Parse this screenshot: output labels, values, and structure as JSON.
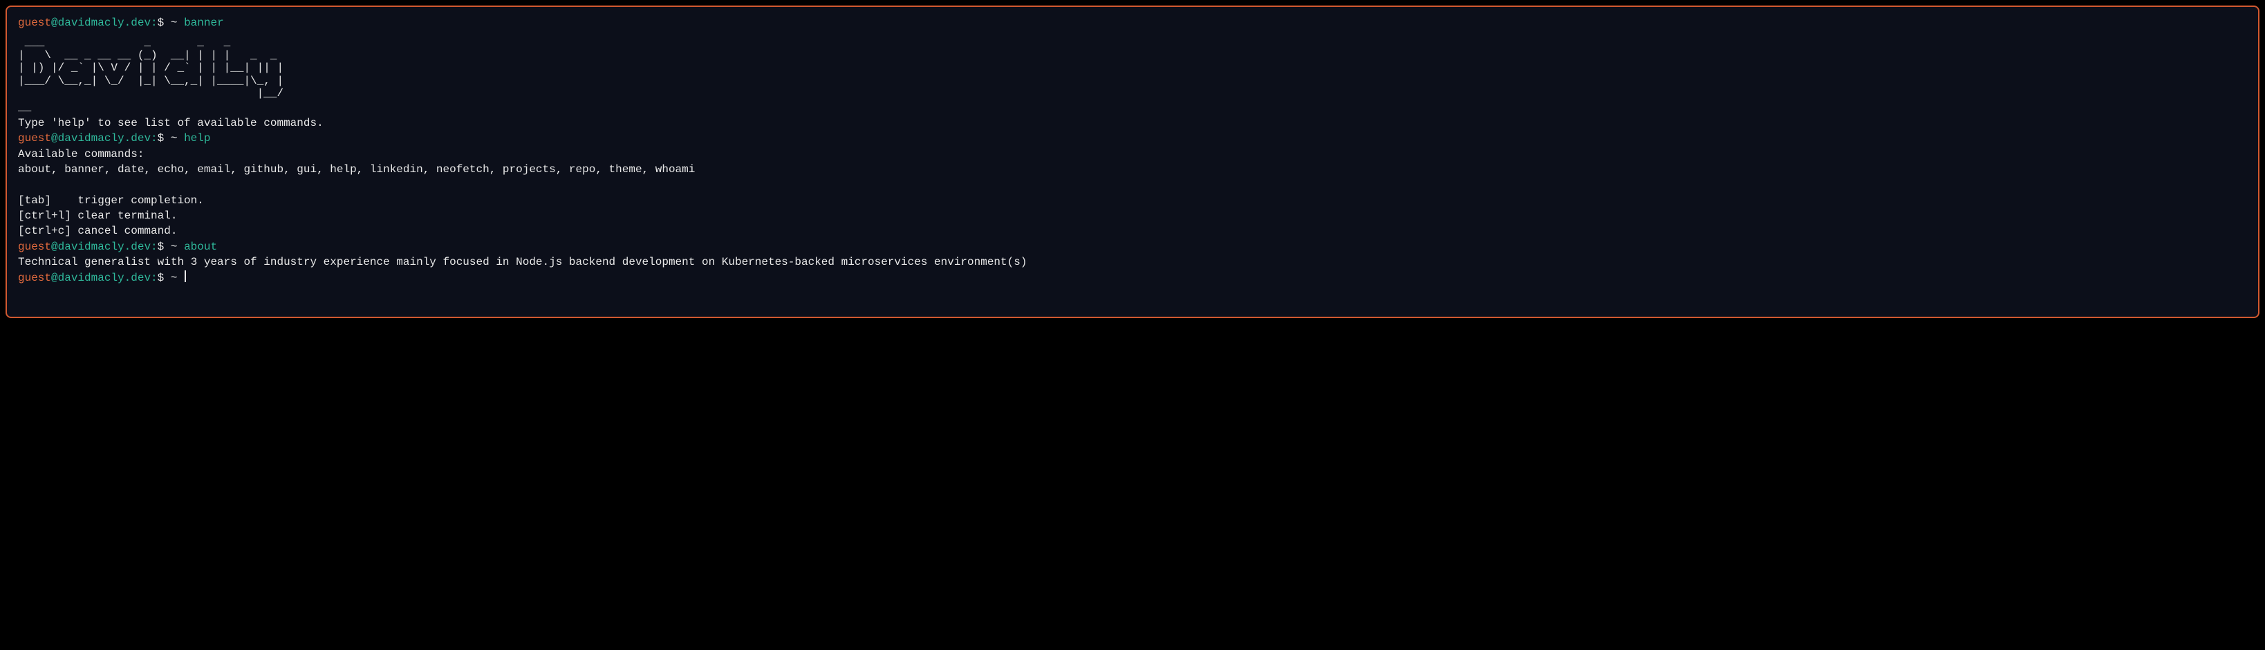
{
  "prompt": {
    "user": "guest",
    "at": "@",
    "host": "davidmacly.dev",
    "sep": ":",
    "dollar": "$ ",
    "tilde": "~ "
  },
  "entries": [
    {
      "command": "banner",
      "output_ascii": " ___               _       _   _        \n|   \\  __ _ __ __ (_)  __| | | |   _  _ \n| |) |/ _` |\\ V / | | / _` | | |__| || |\n|___/ \\__,_| \\_/  |_| \\__,_| |____|\\_, |\n                                    |__/ ",
      "output_lines": [
        "__",
        "Type 'help' to see list of available commands."
      ]
    },
    {
      "command": "help",
      "output_lines": [
        "Available commands:",
        "about, banner, date, echo, email, github, gui, help, linkedin, neofetch, projects, repo, theme, whoami",
        "",
        "[tab]    trigger completion.",
        "[ctrl+l] clear terminal.",
        "[ctrl+c] cancel command."
      ]
    },
    {
      "command": "about",
      "output_lines": [
        "Technical generalist with 3 years of industry experience mainly focused in Node.js backend development on Kubernetes-backed microservices environment(s)"
      ]
    }
  ],
  "current_input": ""
}
